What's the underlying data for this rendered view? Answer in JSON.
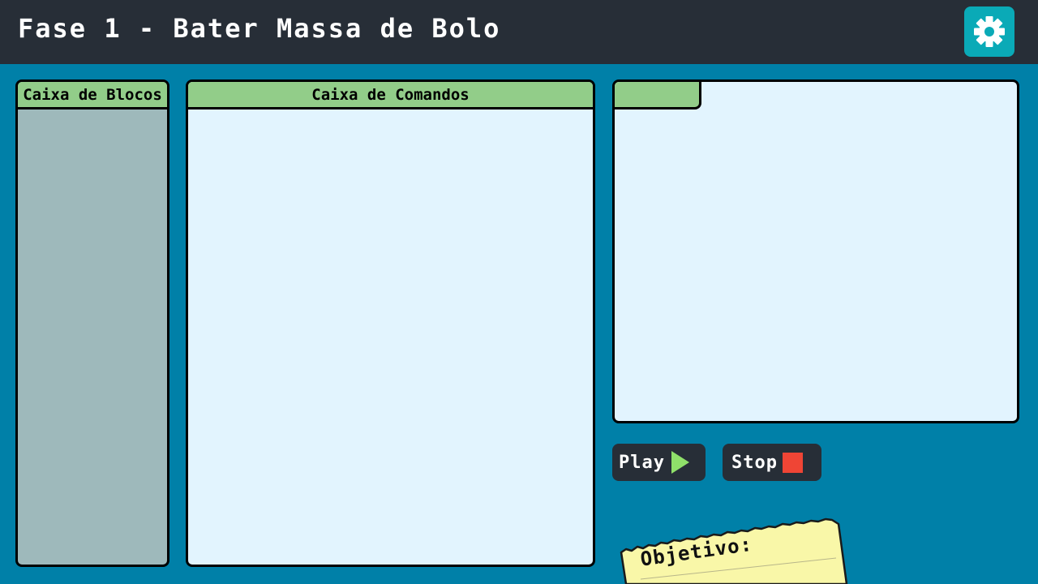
{
  "header": {
    "title": "Fase 1 - Bater Massa de Bolo",
    "settings_icon": "gear-icon"
  },
  "panels": {
    "blocks": {
      "title": "Caixa de Blocos"
    },
    "commands": {
      "title": "Caixa de Comandos"
    },
    "stage": {
      "title": ""
    }
  },
  "controls": {
    "play_label": "Play",
    "play_icon": "play-icon",
    "stop_label": "Stop",
    "stop_icon": "stop-icon"
  },
  "objective": {
    "label": "Objetivo:"
  },
  "colors": {
    "background": "#0080a8",
    "topbar": "#272e37",
    "settings_button": "#0aaab7",
    "panel_header": "#92cd89",
    "blocks_panel": "#9eb9bb",
    "light_panel": "#e2f4fe",
    "play_accent": "#8fe06a",
    "stop_accent": "#ef4535",
    "note_paper": "#f9f7a8"
  }
}
